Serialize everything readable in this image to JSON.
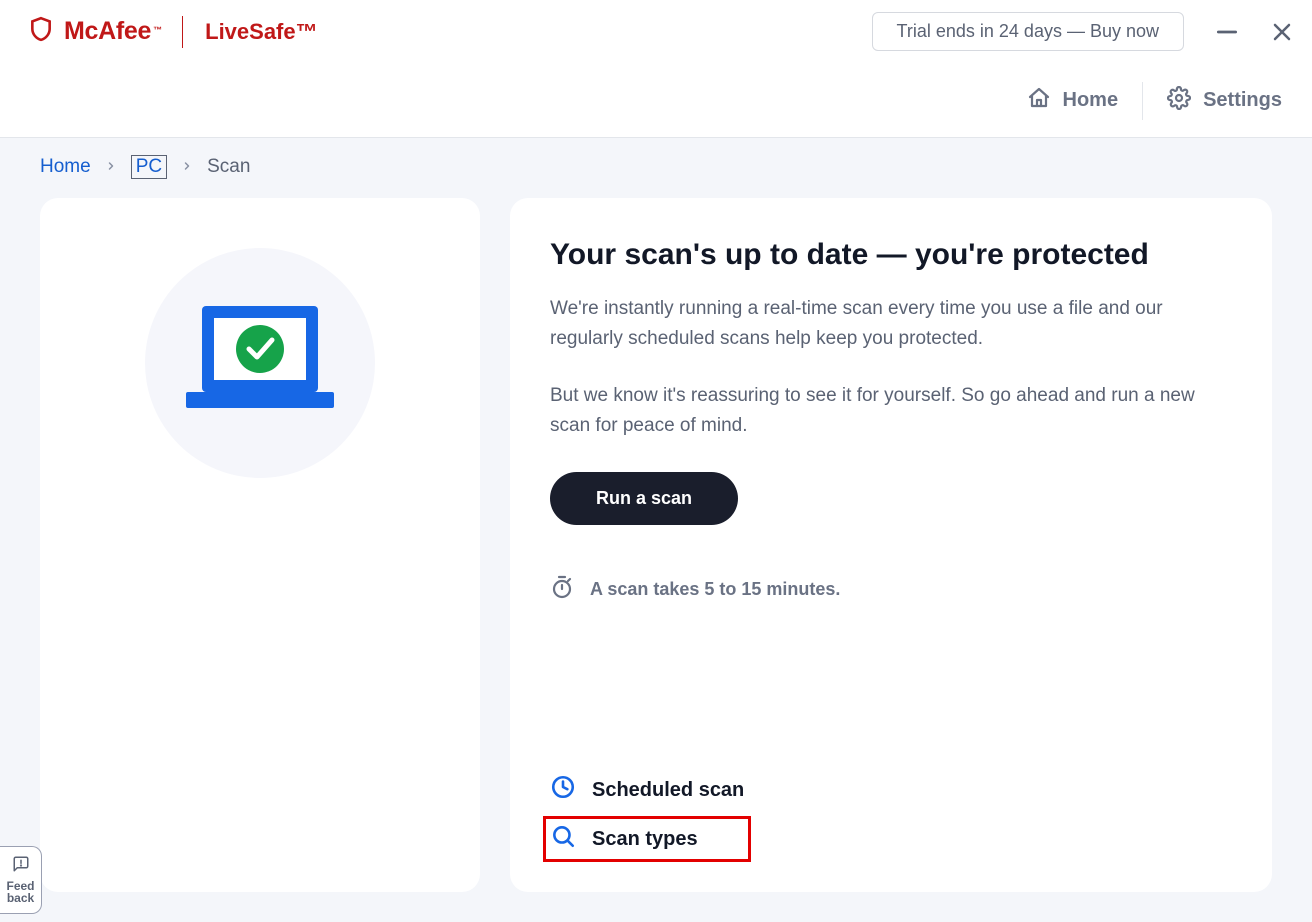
{
  "header": {
    "brand": "McAfee",
    "product": "LiveSafe™",
    "trial_text": "Trial ends in 24 days — Buy now"
  },
  "nav": {
    "home": "Home",
    "settings": "Settings"
  },
  "breadcrumb": {
    "home": "Home",
    "pc": "PC",
    "scan": "Scan"
  },
  "main": {
    "heading": "Your scan's up to date — you're protected",
    "para1": "We're instantly running a real-time scan every time you use a file and our regularly scheduled scans help keep you protected.",
    "para2": "But we know it's reassuring to see it for yourself. So go ahead and run a new scan for peace of mind.",
    "run_button": "Run a scan",
    "scan_time": "A scan takes 5 to 15 minutes.",
    "scheduled_scan": "Scheduled scan",
    "scan_types": "Scan types"
  },
  "feedback": {
    "line1": "Feed",
    "line2": "back"
  }
}
